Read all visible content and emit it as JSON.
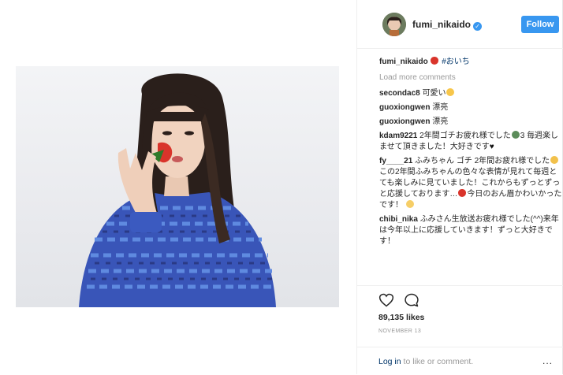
{
  "post": {
    "username": "fumi_nikaido",
    "follow_label": "Follow",
    "verified_mark": "✓"
  },
  "caption": {
    "username": "fumi_nikaido",
    "hashtag": "#おいち"
  },
  "load_more": "Load more comments",
  "comments": [
    {
      "user": "secondac8",
      "text": "可愛い"
    },
    {
      "user": "guoxiongwen",
      "text": "漂亮"
    },
    {
      "user": "guoxiongwen",
      "text": "漂亮"
    },
    {
      "user": "kdam9221",
      "text_a": "2年間ゴチお疲れ様でした",
      "text_b": "3",
      "text_c": "毎週楽しませて頂きました！大好きです"
    },
    {
      "user": "fy____21",
      "text_a": "ふみちゃん ゴチ 2年間お疲れ様でした",
      "text_b": "この2年間ふみちゃんの色々な表情が見れて毎週とても楽しみに見ていました！これからもずっとずっと応援しております…",
      "text_c": "今日のおん眉かわいかったです！"
    },
    {
      "user": "chibi_nika",
      "text": "ふみさん生放送お疲れ様でした(^^)来年は今年以上に応援していきます！ずっと大好きです！"
    }
  ],
  "likes": "89,135 likes",
  "date": "NOVEMBER 13",
  "login": {
    "link": "Log in",
    "rest": "to like or comment.",
    "more": "..."
  },
  "colors": {
    "accent": "#3897f0",
    "hashtag": "#003569",
    "muted": "#999999"
  },
  "icons": [
    "heart-icon",
    "comment-icon",
    "strawberry-icon",
    "verified-icon",
    "more-options-icon"
  ]
}
